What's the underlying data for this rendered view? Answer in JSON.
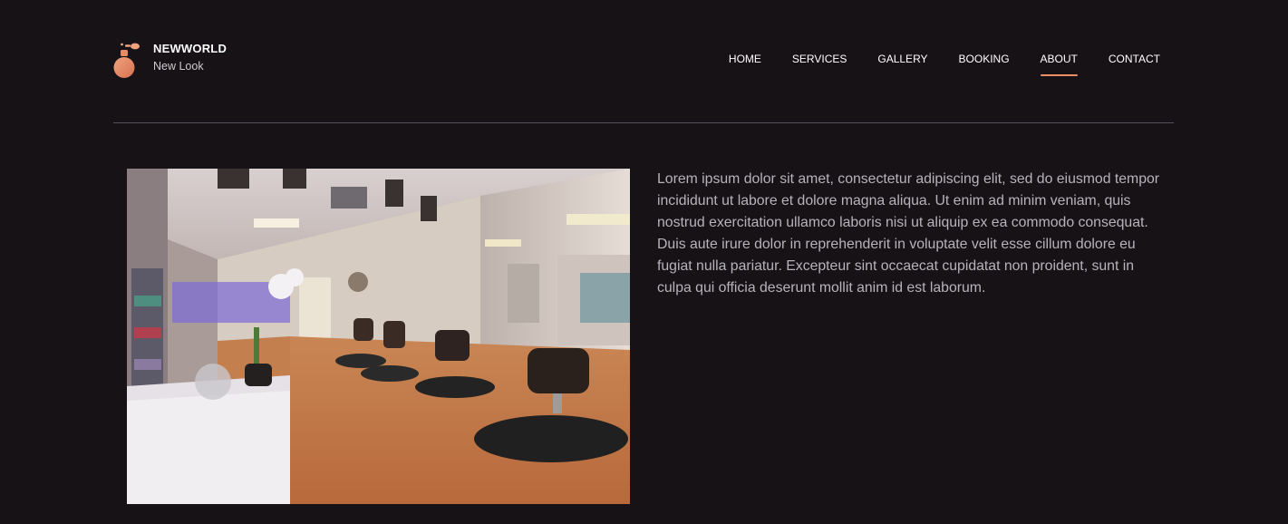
{
  "brand": {
    "name": "NEWWORLD",
    "tagline": "New Look",
    "logo_icon": "perfume-bottle-icon",
    "accent_color": "#e8906c"
  },
  "nav": {
    "items": [
      {
        "label": "HOME",
        "active": false
      },
      {
        "label": "SERVICES",
        "active": false
      },
      {
        "label": "GALLERY",
        "active": false
      },
      {
        "label": "BOOKING",
        "active": false
      },
      {
        "label": "ABOUT",
        "active": true
      },
      {
        "label": "CONTACT",
        "active": false
      }
    ]
  },
  "about": {
    "image_subject": "hair-salon-interior",
    "paragraph": "Lorem ipsum dolor sit amet, consectetur adipiscing elit, sed do eiusmod tempor incididunt ut labore et dolore magna aliqua. Ut enim ad minim veniam, quis nostrud exercitation ullamco laboris nisi ut aliquip ex ea commodo consequat. Duis aute irure dolor in reprehenderit in voluptate velit esse cillum dolore eu fugiat nulla pariatur. Excepteur sint occaecat cupidatat non proident, sunt in culpa qui officia deserunt mollit anim id est laborum."
  }
}
